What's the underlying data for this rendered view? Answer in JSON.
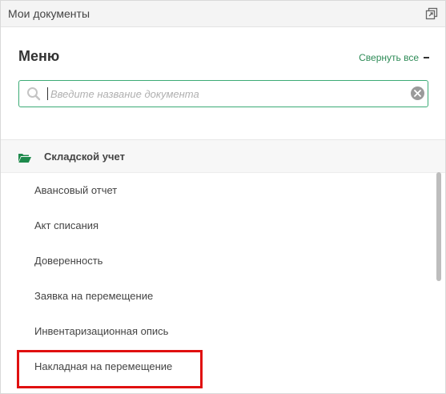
{
  "window": {
    "title": "Мои документы",
    "popout_icon": "popout-icon"
  },
  "menu": {
    "heading": "Меню",
    "collapse_all_label": "Свернуть все"
  },
  "search": {
    "placeholder": "Введите название документа",
    "value": ""
  },
  "section": {
    "label": "Складской учет",
    "icon": "folder-open-icon",
    "icon_color": "#1e8a4c"
  },
  "items": [
    {
      "label": "Авансовый отчет"
    },
    {
      "label": "Акт списания"
    },
    {
      "label": "Доверенность"
    },
    {
      "label": "Заявка на перемещение"
    },
    {
      "label": "Инвентаризационная опись"
    },
    {
      "label": "Накладная на перемещение",
      "highlighted": true
    }
  ],
  "colors": {
    "accent": "#3cab76",
    "link": "#2e8b57",
    "highlight_border": "#e01010"
  }
}
